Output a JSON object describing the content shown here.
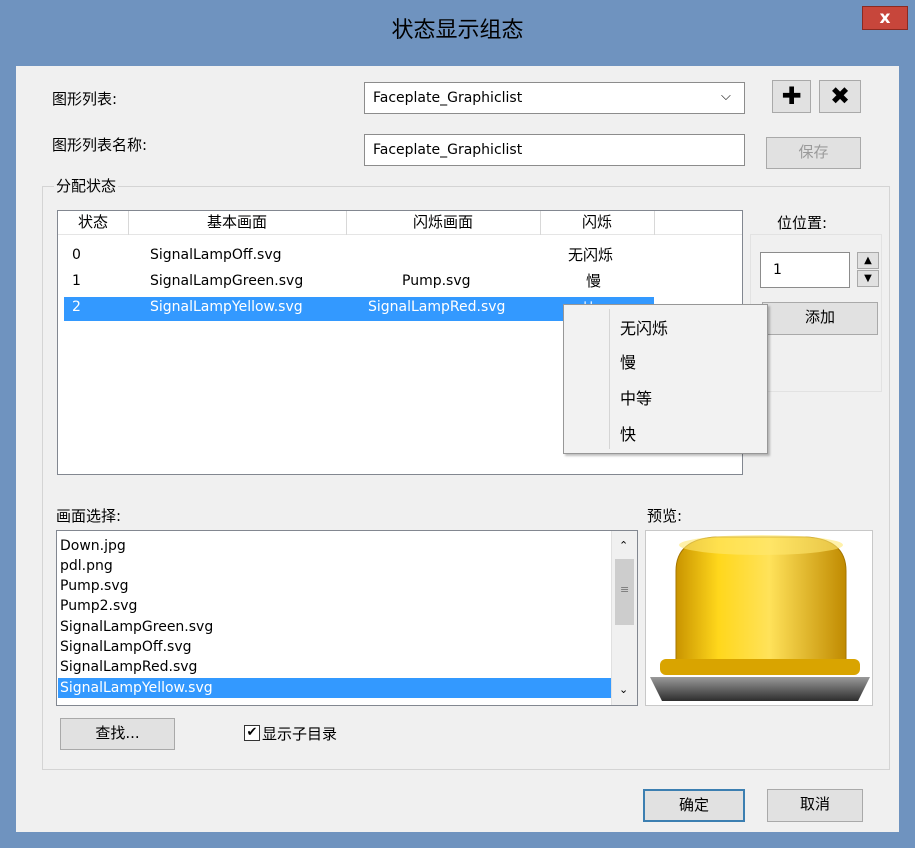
{
  "window": {
    "title": "状态显示组态",
    "close_glyph": "x"
  },
  "graphic_list": {
    "label": "图形列表:",
    "selected": "Faceplate_Graphiclist",
    "name_label": "图形列表名称:",
    "name_value": "Faceplate_Graphiclist",
    "save_label": "保存",
    "add_glyph": "✚",
    "delete_glyph": "✖"
  },
  "assign": {
    "group_label": "分配状态",
    "columns": [
      "状态",
      "基本画面",
      "闪烁画面",
      "闪烁"
    ],
    "rows": [
      {
        "state": "0",
        "base": "SignalLampOff.svg",
        "flash_img": "",
        "flash": "无闪烁"
      },
      {
        "state": "1",
        "base": "SignalLampGreen.svg",
        "flash_img": "Pump.svg",
        "flash": "慢"
      },
      {
        "state": "2",
        "base": "SignalLampYellow.svg",
        "flash_img": "SignalLampRed.svg",
        "flash": "快"
      }
    ]
  },
  "bit": {
    "label": "位位置:",
    "value": "1",
    "add_label": "添加"
  },
  "dropdown_menu": [
    "无闪烁",
    "慢",
    "中等",
    "快"
  ],
  "image_select": {
    "label": "画面选择:",
    "items": [
      "Down.jpg",
      "pdl.png",
      "Pump.svg",
      "Pump2.svg",
      "SignalLampGreen.svg",
      "SignalLampOff.svg",
      "SignalLampRed.svg",
      "SignalLampYellow.svg"
    ],
    "selected": "SignalLampYellow.svg"
  },
  "preview": {
    "label": "预览:"
  },
  "search_label": "查找...",
  "show_subdir": {
    "label": "显示子目录",
    "checked": true
  },
  "ok_label": "确定",
  "cancel_label": "取消",
  "colors": {
    "title_bar": "#6f93bf",
    "selection": "#3399ff",
    "close": "#c7463b",
    "lamp": "#f2c200"
  }
}
